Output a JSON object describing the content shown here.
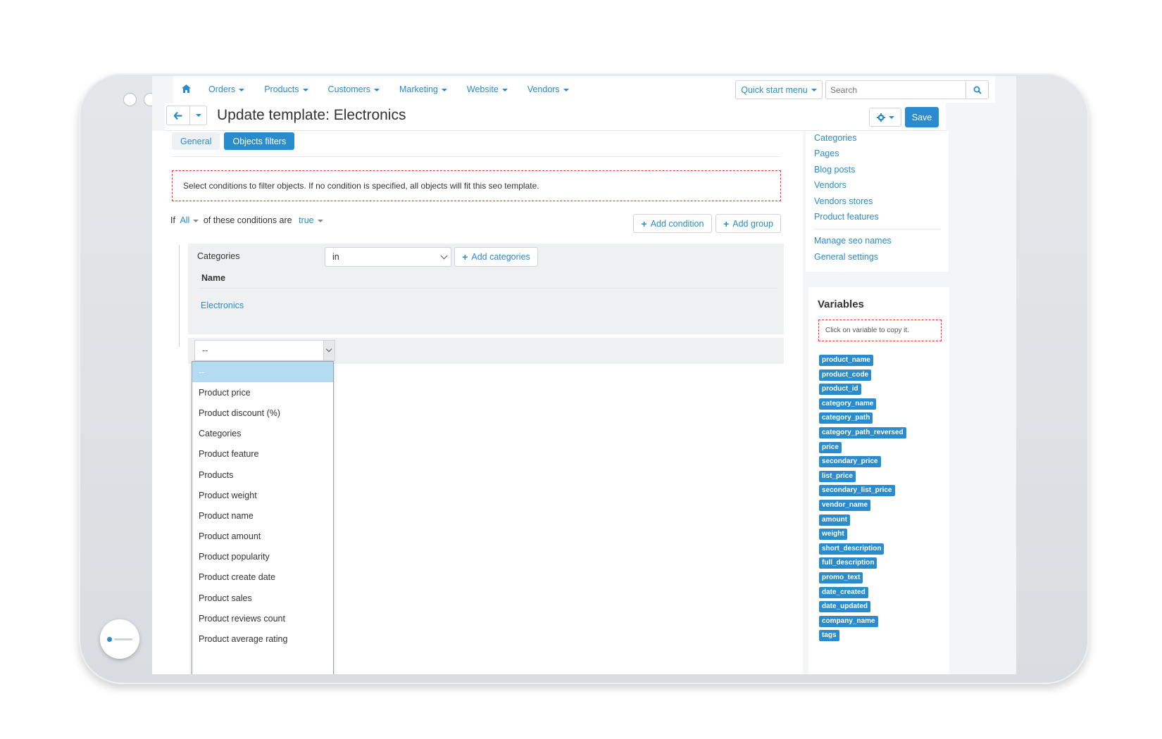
{
  "nav": {
    "items": [
      {
        "label": "Orders"
      },
      {
        "label": "Products"
      },
      {
        "label": "Customers"
      },
      {
        "label": "Marketing"
      },
      {
        "label": "Website"
      },
      {
        "label": "Vendors"
      }
    ],
    "quick_start": "Quick start menu",
    "search_placeholder": "Search"
  },
  "header": {
    "title": "Update template: Electronics",
    "save_label": "Save"
  },
  "tabs": [
    {
      "label": "General",
      "active": false
    },
    {
      "label": "Objects filters",
      "active": true
    }
  ],
  "notice": "Select conditions to filter objects. If no condition is specified, all objects will fit this seo template.",
  "conditions": {
    "prefix": "If",
    "all_label": "All",
    "middle": "of these conditions are",
    "true_label": "true",
    "add_condition": "Add condition",
    "add_group": "Add group"
  },
  "category_condition": {
    "label": "Categories",
    "operator": "in",
    "add_categories": "Add categories",
    "name_header": "Name",
    "values": [
      "Electronics"
    ]
  },
  "new_condition": {
    "selected": "--",
    "options": [
      "--",
      "Product price",
      "Product discount (%)",
      "Categories",
      "Product feature",
      "Products",
      "Product weight",
      "Product name",
      "Product amount",
      "Product popularity",
      "Product create date",
      "Product sales",
      "Product reviews count",
      "Product average rating"
    ]
  },
  "sidebar": {
    "links": [
      "Categories",
      "Pages",
      "Blog posts",
      "Vendors",
      "Vendors stores",
      "Product features"
    ],
    "links2": [
      "Manage seo names",
      "General settings"
    ]
  },
  "variables": {
    "title": "Variables",
    "hint": "Click on variable to copy it.",
    "tags": [
      "product_name",
      "product_code",
      "product_id",
      "category_name",
      "category_path",
      "category_path_reversed",
      "price",
      "secondary_price",
      "list_price",
      "secondary_list_price",
      "vendor_name",
      "amount",
      "weight",
      "short_description",
      "full_description",
      "promo_text",
      "date_created",
      "date_updated",
      "company_name",
      "tags"
    ]
  },
  "colors": {
    "accent": "#2b8ccd",
    "notice_border": "#e8312f",
    "selected_option": "#b3dcf2"
  }
}
